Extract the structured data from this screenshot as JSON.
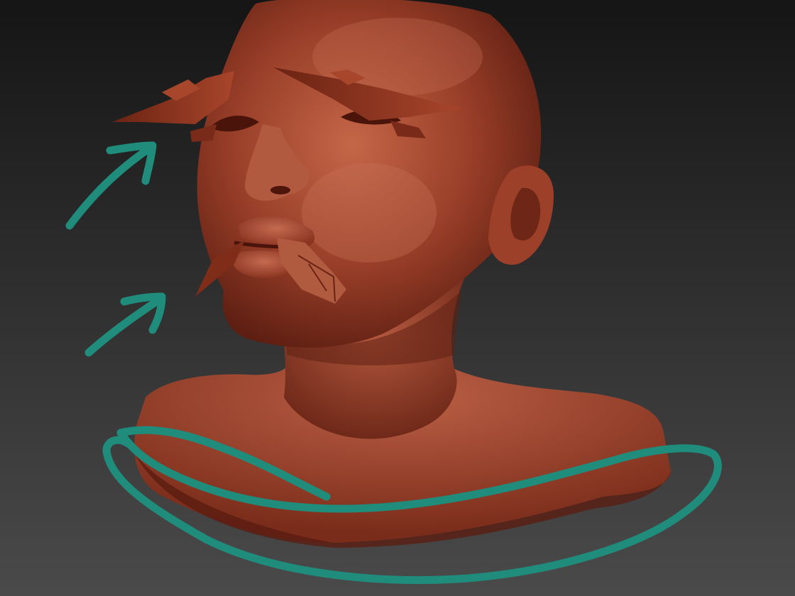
{
  "viewport": {
    "background_top": "#151515",
    "background_bottom": "#4a4a4a"
  },
  "model": {
    "skin_base": "#a8472f",
    "skin_light": "#c86a50",
    "skin_dark": "#5c1e12",
    "artifact_color": "#8a3520"
  },
  "annotations": {
    "color": "#1f8c7c"
  }
}
